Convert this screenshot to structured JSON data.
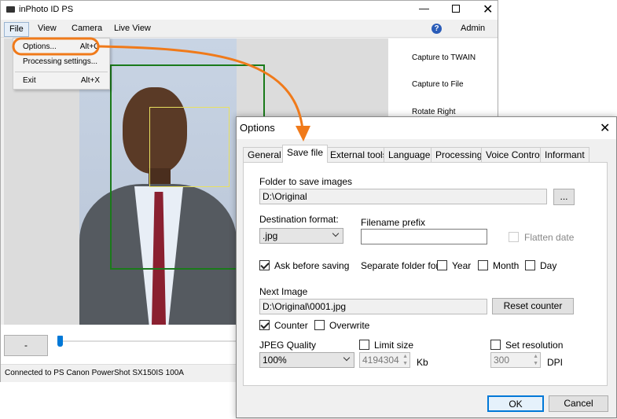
{
  "app": {
    "title": "inPhoto ID PS",
    "menu": [
      "File",
      "View",
      "Camera",
      "Live View"
    ],
    "help_icon": "question-circle-icon",
    "admin": "Admin",
    "file_menu": [
      {
        "label": "Options...",
        "shortcut": "Alt+O"
      },
      {
        "label": "Processing settings...",
        "shortcut": ""
      },
      {
        "label": "Exit",
        "shortcut": "Alt+X"
      }
    ],
    "side_buttons": [
      "Capture to TWAIN",
      "Capture to File",
      "Rotate Right"
    ],
    "minus_button": "-",
    "status": "Connected to PS Canon PowerShot SX150IS 100A"
  },
  "dialog": {
    "title": "Options",
    "tabs": [
      "General",
      "Save file",
      "External tools",
      "Language",
      "Processing",
      "Voice Control",
      "Informant"
    ],
    "selected_tab": "Save file",
    "folder_label": "Folder to save images",
    "folder_value": "D:\\Original",
    "browse": "...",
    "dest_label": "Destination format:",
    "dest_value": ".jpg",
    "prefix_label": "Filename prefix",
    "prefix_value": "",
    "flatten_date": "Flatten date",
    "ask_before_saving": "Ask before saving",
    "separate_folder": "Separate folder for",
    "year": "Year",
    "month": "Month",
    "day": "Day",
    "next_image_label": "Next Image",
    "next_image_value": "D:\\Original\\0001.jpg",
    "reset_counter": "Reset counter",
    "counter": "Counter",
    "overwrite": "Overwrite",
    "jpeg_quality_label": "JPEG Quality",
    "jpeg_quality_value": "100%",
    "limit_size": "Limit size",
    "limit_value": "4194304",
    "kb": "Kb",
    "set_resolution": "Set resolution",
    "resolution_value": "300",
    "dpi": "DPI",
    "ok": "OK",
    "cancel": "Cancel"
  },
  "colors": {
    "highlight": "#f07a1a",
    "face_frame": "#1a7a1a",
    "eye_frame": "#e8e060",
    "accent": "#0078d7"
  }
}
